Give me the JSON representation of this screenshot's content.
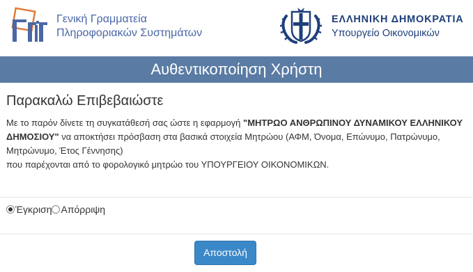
{
  "header": {
    "gsis_name_line1": "Γενική Γραμματεία",
    "gsis_name_line2": "Πληροφοριακών Συστημάτων",
    "gov_title": "ΕΛΛΗΝΙΚΗ ΔΗΜΟΚΡΑΤΙΑ",
    "gov_subtitle": "Υπουργείο Οικονομικών",
    "gsis_logo_icon": "gsis-logo-icon",
    "emblem_icon": "greek-coat-of-arms-icon"
  },
  "page": {
    "title": "Αυθεντικοποίηση Χρήστη",
    "heading": "Παρακαλώ Επιβεβαιώστε"
  },
  "consent": {
    "part1": "Με το παρόν δίνετε τη συγκατάθεσή σας ώστε η εφαρμογή ",
    "app_name": "\"ΜΗΤΡΩΟ ΑΝΘΡΩΠΙΝΟΥ ΔΥΝΑΜΙΚΟΥ ΕΛΛΗΝΙΚΟΥ ΔΗΜΟΣΙΟΥ\"",
    "part2": " να αποκτήσει πρόσβαση στα βασικά στοιχεία Μητρώου (ΑΦΜ, Όνομα, Επώνυμο, Πατρώνυμο, Μητρώνυμο, Έτος Γέννησης)",
    "part3": "που παρέχονται από το φορολογικό μητρώο του ΥΠΟΥΡΓΕΙΟΥ ΟΙΚΟΝΟΜΙΚΩΝ."
  },
  "options": {
    "approve_label": "Έγκριση",
    "reject_label": "Απόρριψη",
    "selected": "approve"
  },
  "actions": {
    "submit_label": "Αποστολή"
  },
  "colors": {
    "title_bar": "#5a7ba3",
    "brand_blue": "#1f3f7a",
    "gsis_blue": "#4a67a6",
    "gsis_orange": "#e07b39",
    "button": "#3b88c9"
  }
}
